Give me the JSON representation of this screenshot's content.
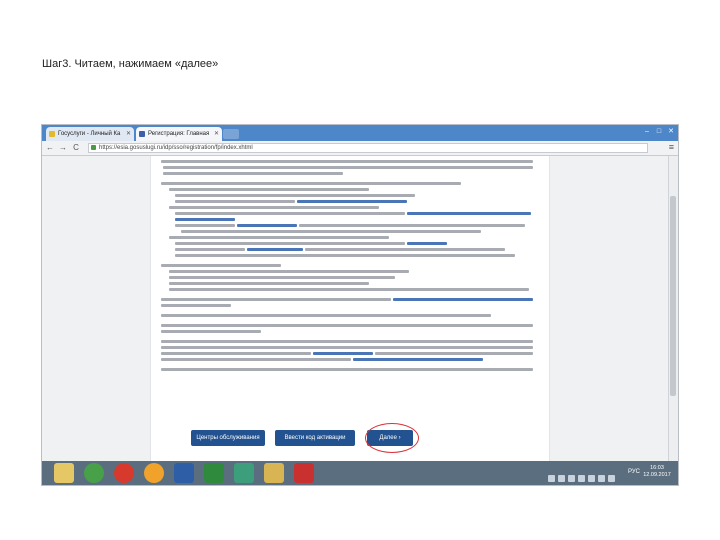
{
  "caption": "Шаг3. Читаем, нажимаем «далее»",
  "browser": {
    "tabs": [
      {
        "title": "Госуслуги - Личный Ка",
        "icon_color": "#e5b92c",
        "active": false
      },
      {
        "title": "Регистрация: Главная",
        "icon_color": "#3d5fa8",
        "active": true
      }
    ],
    "window_controls": {
      "minimize": "–",
      "maximize": "□",
      "close": "✕"
    },
    "nav": {
      "back": "←",
      "forward": "→",
      "reload": "C",
      "menu": "≡"
    },
    "url": "https://esia.gosuslugi.ru/idp/sso/registration/fp/index.xhtml"
  },
  "page": {
    "buttons": {
      "centers": "Центры обслуживания",
      "check": "Ввести код активации",
      "next": "Далее ›"
    }
  },
  "taskbar": {
    "apps": [
      {
        "name": "file-manager-icon",
        "color": "#e6c766"
      },
      {
        "name": "chrome-icon",
        "color": "#48a048"
      },
      {
        "name": "yandex-icon",
        "color": "#d73a2c"
      },
      {
        "name": "media-icon",
        "color": "#f0a22a"
      },
      {
        "name": "word-icon",
        "color": "#2e5fa6"
      },
      {
        "name": "excel-icon",
        "color": "#2f8a3e"
      },
      {
        "name": "chart-icon",
        "color": "#3c9e7a"
      },
      {
        "name": "folder-icon",
        "color": "#d9b453"
      },
      {
        "name": "pdf-icon",
        "color": "#c8312f"
      }
    ],
    "lang": "РУС",
    "time": "16:03",
    "date": "12.09.2017"
  },
  "colors": {
    "tabbar": "#4d86c9",
    "button": "#22528f",
    "link": "#4a76b8",
    "highlight": "#d9343a",
    "taskbar": "#5b6e80"
  }
}
